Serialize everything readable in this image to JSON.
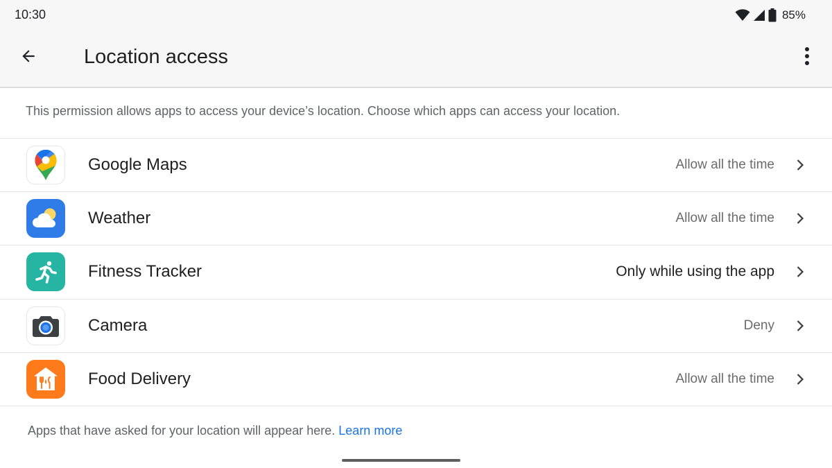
{
  "status_bar": {
    "time": "10:30",
    "battery_percent": "85%",
    "icons": [
      "wifi-icon",
      "cellular-signal-icon",
      "battery-icon"
    ]
  },
  "app_bar": {
    "title": "Location access",
    "back_icon": "arrow-back-icon",
    "more_icon": "more-vert-icon"
  },
  "description": "This permission allows apps to access your device’s location. Choose which apps can access your location.",
  "apps": [
    {
      "name": "Google Maps",
      "permission": "Allow all the time",
      "icon": "google-maps-icon"
    },
    {
      "name": "Weather",
      "permission": "Allow all the time",
      "icon": "weather-icon"
    },
    {
      "name": "Fitness Tracker",
      "permission": "Only while using the app",
      "icon": "fitness-tracker-icon"
    },
    {
      "name": "Camera",
      "permission": "Deny",
      "icon": "camera-icon"
    },
    {
      "name": "Food Delivery",
      "permission": "Allow all the time",
      "icon": "food-delivery-icon"
    }
  ],
  "footer": {
    "note": "Apps that have asked for your location will appear here.",
    "link_label": "Learn more"
  },
  "colors": {
    "link": "#1a73e8",
    "weather_bg": "#2f7be8",
    "fitness_bg": "#26b5a2",
    "food_bg": "#ff7a1a"
  }
}
